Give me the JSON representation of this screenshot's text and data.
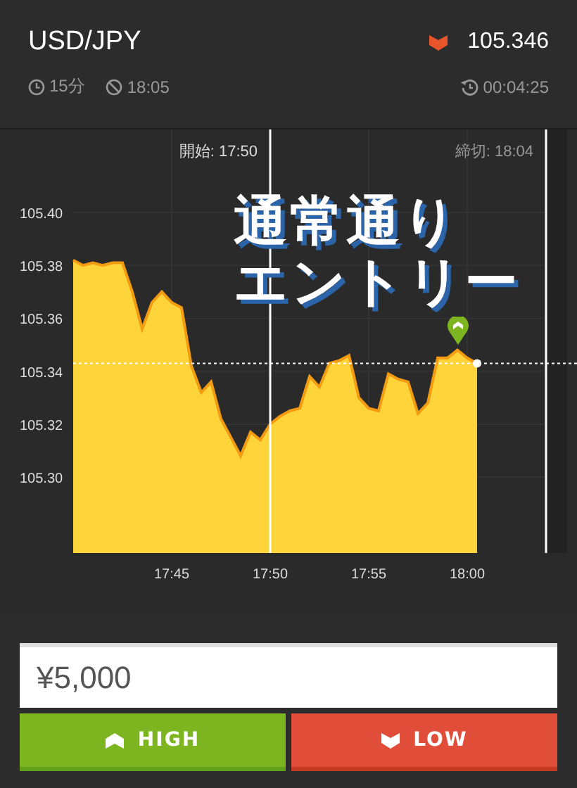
{
  "header": {
    "symbol": "USD/JPY",
    "quote": {
      "price": "105.346"
    },
    "duration": "15分",
    "expiry": "18:05",
    "remaining": "00:04:25"
  },
  "chart": {
    "start_label": "開始: 17:50",
    "end_label": "締切: 18:04",
    "chart_data": {
      "type": "area",
      "categories": [
        null,
        null,
        null,
        null,
        null,
        null,
        null,
        null,
        null,
        null,
        "17:45",
        null,
        null,
        null,
        null,
        null,
        null,
        null,
        null,
        null,
        "17:50",
        null,
        null,
        null,
        null,
        null,
        null,
        null,
        null,
        null,
        "17:55",
        null,
        null,
        null,
        null,
        null,
        null,
        null,
        null,
        null,
        "18:00",
        null
      ],
      "series": [
        {
          "color": "#ffd43b",
          "values": [
            105.382,
            105.38,
            105.381,
            105.38,
            105.381,
            105.381,
            105.37,
            105.356,
            105.366,
            105.37,
            105.366,
            105.364,
            105.342,
            105.332,
            105.336,
            105.322,
            105.315,
            105.308,
            105.317,
            105.314,
            105.32,
            105.323,
            105.325,
            105.326,
            105.338,
            105.334,
            105.343,
            105.344,
            105.346,
            105.33,
            105.326,
            105.325,
            105.339,
            105.337,
            105.336,
            105.324,
            105.328,
            105.345,
            105.345,
            105.348,
            105.345,
            105.343
          ]
        }
      ],
      "ylim": [
        105.2713,
        105.4314
      ],
      "grid": true,
      "ref_lines": [
        {
          "axis": "y",
          "value": 105.343
        }
      ],
      "yticks": [
        {
          "value": 105.3,
          "label": "105.30"
        },
        {
          "value": 105.32,
          "label": "105.32"
        },
        {
          "value": 105.34,
          "label": "105.34"
        },
        {
          "value": 105.36,
          "label": "105.36"
        },
        {
          "value": 105.38,
          "label": "105.38"
        },
        {
          "value": 105.4,
          "label": "105.40"
        }
      ]
    }
  },
  "caption": [
    "通常通り",
    "エントリー"
  ],
  "trade": {
    "amount": "¥5,000",
    "buttons": [
      {
        "kind": "high",
        "label": "HIGH"
      },
      {
        "kind": "low",
        "label": "LOW"
      }
    ]
  }
}
